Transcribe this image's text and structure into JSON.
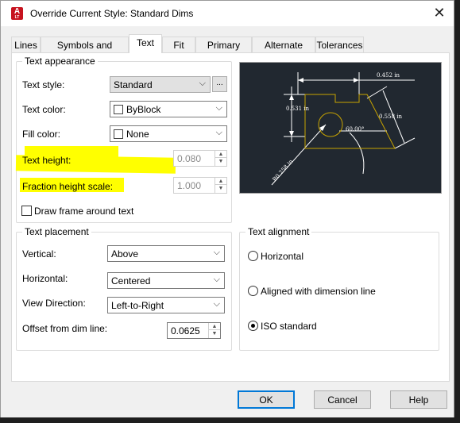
{
  "window": {
    "title": "Override Current Style: Standard Dims",
    "app_icon_letter": "A",
    "app_icon_sub": "LT",
    "close_glyph": "✕"
  },
  "tabs": [
    {
      "label": "Lines",
      "active": false
    },
    {
      "label": "Symbols and Arrows",
      "active": false
    },
    {
      "label": "Text",
      "active": true
    },
    {
      "label": "Fit",
      "active": false
    },
    {
      "label": "Primary Units",
      "active": false
    },
    {
      "label": "Alternate Units",
      "active": false
    },
    {
      "label": "Tolerances",
      "active": false
    }
  ],
  "text_appearance": {
    "group_label": "Text appearance",
    "text_style_label": "Text style:",
    "text_style_value": "Standard",
    "browse_label": "...",
    "text_color_label": "Text color:",
    "text_color_value": "ByBlock",
    "fill_color_label": "Fill color:",
    "fill_color_value": "None",
    "text_height_label": "Text height:",
    "text_height_value": "0.080",
    "fraction_height_label": "Fraction height scale:",
    "fraction_height_value": "1.000",
    "draw_frame_label": "Draw frame around text",
    "draw_frame_checked": false,
    "highlight_color": "#ffff00"
  },
  "text_placement": {
    "group_label": "Text placement",
    "vertical_label": "Vertical:",
    "vertical_value": "Above",
    "horizontal_label": "Horizontal:",
    "horizontal_value": "Centered",
    "view_direction_label": "View Direction:",
    "view_direction_value": "Left-to-Right",
    "offset_label": "Offset from dim line:",
    "offset_value": "0.0625"
  },
  "text_alignment": {
    "group_label": "Text alignment",
    "options": [
      {
        "label": "Horizontal",
        "selected": false
      },
      {
        "label": "Aligned with dimension line",
        "selected": false
      },
      {
        "label": "ISO standard",
        "selected": true
      }
    ]
  },
  "preview": {
    "dim_top": "0.452 in",
    "dim_left": "0.531 in",
    "dim_right": "0.558 in",
    "dim_angle": "60.00°",
    "dim_radius": "R0.258 in",
    "background": "#212830",
    "shape_color": "#c8a400"
  },
  "buttons": {
    "ok": "OK",
    "cancel": "Cancel",
    "help": "Help"
  }
}
